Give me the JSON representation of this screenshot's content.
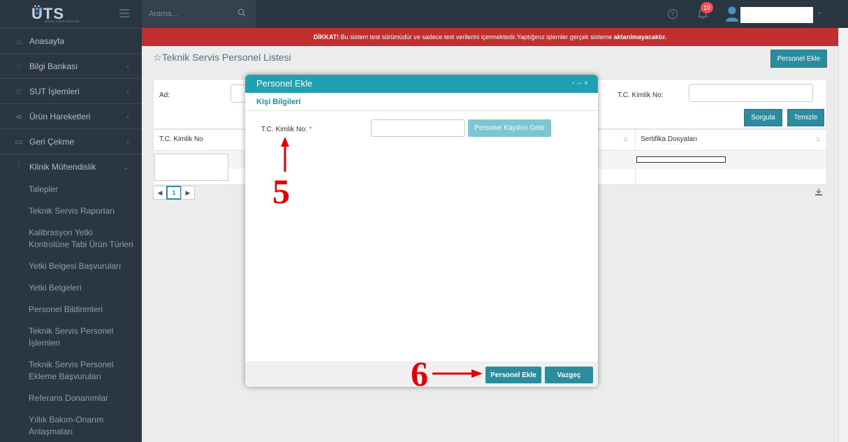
{
  "app": {
    "logo_text": "ÜTS",
    "logo_sub": "ÜRÜN TAKİP SİSTEMİ"
  },
  "topbar": {
    "search_placeholder": "Arama...",
    "notification_count": "10"
  },
  "sidebar": {
    "items": [
      {
        "label": "Anasayfa",
        "icon": "home-icon",
        "has_chevron": false
      },
      {
        "label": "Bilgi Bankası",
        "icon": "bulb-icon",
        "has_chevron": true
      },
      {
        "label": "SUT İşlemleri",
        "icon": "star-icon",
        "has_chevron": true
      },
      {
        "label": "Ürün Hareketleri",
        "icon": "share-icon",
        "has_chevron": true
      },
      {
        "label": "Geri Çekme",
        "icon": "screen-icon",
        "has_chevron": true
      },
      {
        "label": "Klinik Mühendislik",
        "icon": "sliders-icon",
        "has_chevron": true
      }
    ],
    "subitems": [
      "Talepler",
      "Teknik Servis Raporları",
      "Kalibrasyon Yetki Kontrolüne Tabi Ürün Türleri",
      "Yetki Belgesi Başvuruları",
      "Yetki Belgeleri",
      "Personel Bildirimleri",
      "Teknik Servis Personel İşlemleri",
      "Teknik Servis Personel Ekleme Başvuruları",
      "Referans Donanımlar",
      "Yıllık Bakım-Onarım Anlaşmaları"
    ]
  },
  "warning": {
    "bold_prefix": "DİKKAT!",
    "text": " Bu sistem test sürümüdür ve sadece test verilerini içermektedir.Yaptığınız işlemler gerçek sisteme ",
    "bold_suffix": "aktarılmayacaktır."
  },
  "page": {
    "title": "Teknik Servis Personel Listesi",
    "add_button": "Personel Ekle"
  },
  "filter": {
    "ad_label": "Ad:",
    "tc_label": "T.C. Kimlik No:",
    "search_button": "Sorgula",
    "clear_button": "Temizle"
  },
  "table": {
    "columns": [
      "T.C. Kimlik No",
      "Sertifika Dosyaları"
    ],
    "page": "1"
  },
  "modal": {
    "title": "Personel Ekle",
    "section": "Kişi Bilgileri",
    "tc_label": "T.C. Kimlik No:",
    "required_mark": "*",
    "tc_value": "",
    "fetch_button": "Personel Kaydını Getir",
    "add_button": "Personel Ekle",
    "cancel_button": "Vazgeç"
  },
  "annotations": {
    "step5": "5",
    "step6": "6"
  },
  "colors": {
    "accent": "#2b8c9e",
    "sidebar": "#2b3643",
    "warning": "#c12f2f",
    "annotation": "#e00000"
  }
}
